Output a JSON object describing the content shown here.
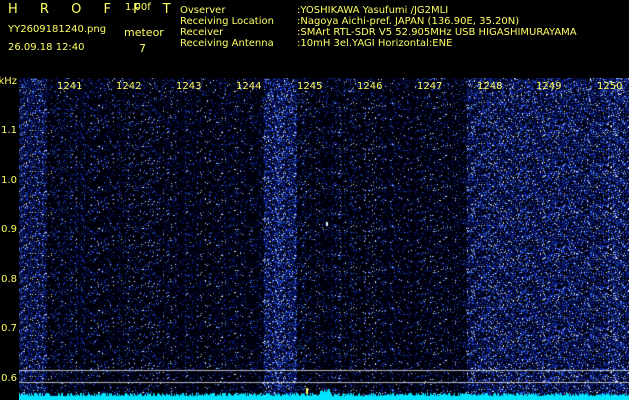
{
  "header": {
    "brand": "H R O F F T",
    "version": "1.00f",
    "filename": "YY2609181240.png",
    "meteor_label": "meteor",
    "datetime": "26.09.18 12:40",
    "meteor_count": "7",
    "info": [
      {
        "key": "Ovserver",
        "value": ":YOSHIKAWA Yasufumi /JG2MLI"
      },
      {
        "key": "Receiving Location",
        "value": ":Nagoya Aichi-pref. JAPAN (136.90E, 35.20N)"
      },
      {
        "key": "Receiver",
        "value": ":SMArt RTL-SDR V5 52.905MHz USB HIGASHIMURAYAMA"
      },
      {
        "key": "Receiving Antenna",
        "value": ":10mH 3el.YAGI Horizontal:ENE"
      }
    ]
  },
  "spectrogram": {
    "y_unit": "kHz",
    "y_ticks": [
      "1.1",
      "1.0",
      "0.9",
      "0.8",
      "0.7",
      "0.6"
    ],
    "x_ticks": [
      "1241",
      "1242",
      "1243",
      "1244",
      "1245",
      "1246",
      "1247",
      "1248",
      "1249",
      "1250"
    ],
    "colors": {
      "background": "#000010",
      "noise": "#1a2fa0",
      "bright": "#ffffff",
      "trace": "#00e5ff",
      "text": "#ffff66"
    }
  }
}
